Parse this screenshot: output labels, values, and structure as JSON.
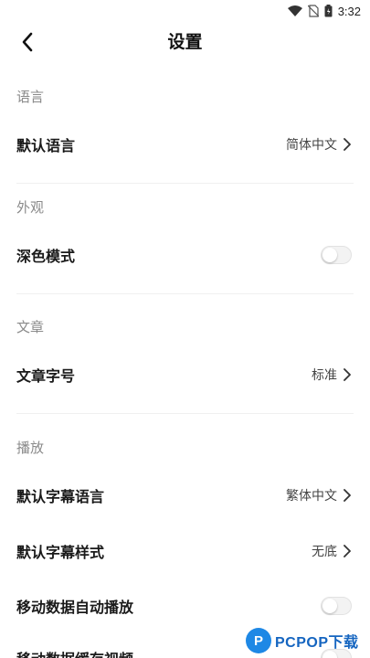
{
  "status_bar": {
    "time": "3:32"
  },
  "header": {
    "title": "设置"
  },
  "sections": {
    "language": {
      "title": "语言",
      "default_language": {
        "label": "默认语言",
        "value": "简体中文"
      }
    },
    "appearance": {
      "title": "外观",
      "dark_mode": {
        "label": "深色模式",
        "enabled": false
      }
    },
    "article": {
      "title": "文章",
      "font_size": {
        "label": "文章字号",
        "value": "标准"
      }
    },
    "playback": {
      "title": "播放",
      "subtitle_language": {
        "label": "默认字幕语言",
        "value": "繁体中文"
      },
      "subtitle_style": {
        "label": "默认字幕样式",
        "value": "无底"
      },
      "mobile_autoplay": {
        "label": "移动数据自动播放",
        "enabled": false
      },
      "mobile_cache": {
        "label": "移动数据缓存视频",
        "enabled": false
      }
    }
  },
  "watermark": {
    "logo_letter": "P",
    "text": "PCPOP下载"
  }
}
